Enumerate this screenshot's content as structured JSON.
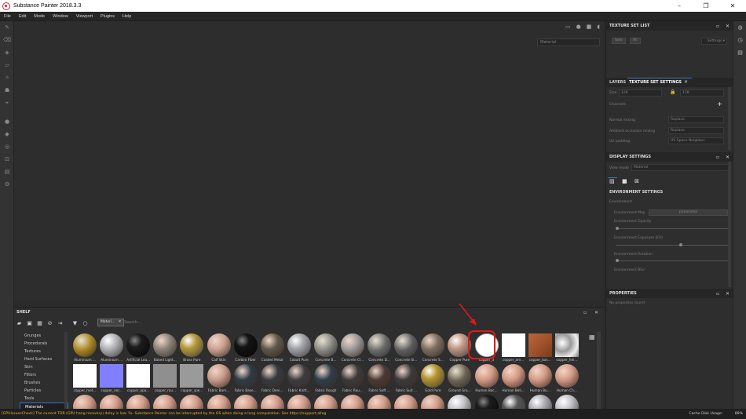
{
  "app": {
    "title": "Substance Painter 2018.3.3",
    "window_controls": [
      "–",
      "❐",
      "✕"
    ]
  },
  "menu": [
    "File",
    "Edit",
    "Mode",
    "Window",
    "Viewport",
    "Plugins",
    "Help"
  ],
  "viewport": {
    "material_label": "Material"
  },
  "texture_set_list": {
    "title": "TEXTURE SET LIST",
    "btn_a": "Solo",
    "btn_b": "All",
    "settings_label": "Settings ▾"
  },
  "tabs": {
    "layers": "LAYERS",
    "texture_set_settings": "TEXTURE SET SETTINGS"
  },
  "texture_set_settings": {
    "size_label": "Size",
    "size_a": "128",
    "size_b": "128",
    "channels_label": "Channels",
    "normal_mixing_label": "Normal mixing",
    "normal_mixing_value": "Replace",
    "ao_mixing_label": "Ambient occlusion mixing",
    "ao_mixing_value": "Replace",
    "uv_padding_label": "UV padding",
    "uv_padding_value": "UV Space Neighbor"
  },
  "display_settings": {
    "title": "DISPLAY SETTINGS",
    "view_mode_label": "View mode",
    "view_mode_value": "Material",
    "env_settings_title": "ENVIRONMENT SETTINGS",
    "environment_label": "Environment",
    "env_map_label": "Environment Map",
    "env_map_value": "panorama",
    "env_opacity_label": "Environment Opacity",
    "env_exposure_label": "Environment Exposure (EV)",
    "env_rotation_label": "Environment Rotation",
    "env_blur_label": "Environment Blur",
    "env_opacity_value": 0.0,
    "env_exposure_value": 0.58,
    "env_rotation_value": 0.0
  },
  "properties": {
    "title": "PROPERTIES",
    "empty_text": "No properties found"
  },
  "shelf": {
    "title": "SHELF",
    "filter_chip": "Materi...",
    "search_placeholder": "Search...",
    "categories": [
      "Grunges",
      "Procedurals",
      "Textures",
      "Hard Surfaces",
      "Skin",
      "Filters",
      "Brushes",
      "Particles",
      "Tools",
      "Materials"
    ],
    "active_category": "Materials",
    "row1": [
      {
        "name": "Aluminium ...",
        "color": "#a88420",
        "style": "grain"
      },
      {
        "name": "Aluminium ...",
        "color": "#b9b9bd",
        "style": "metal"
      },
      {
        "name": "Artificial Lea...",
        "color": "#1c1c1c",
        "style": "dark"
      },
      {
        "name": "Baked Light...",
        "color": "#8a8378",
        "style": "matte"
      },
      {
        "name": "Brass Pure",
        "color": "#b59a3a",
        "style": "metal"
      },
      {
        "name": "Calf Skin",
        "color": "#caa292",
        "style": "matte"
      },
      {
        "name": "Carbon Fiber",
        "color": "#141414",
        "style": "dark"
      },
      {
        "name": "Coated Metal",
        "color": "#5c5649",
        "style": "matte"
      },
      {
        "name": "Cobalt Pure",
        "color": "#a5a7ad",
        "style": "metal"
      },
      {
        "name": "Concrete B...",
        "color": "#888580",
        "style": "grain"
      },
      {
        "name": "Concrete Cl...",
        "color": "#9a9a9a",
        "style": "matte"
      },
      {
        "name": "Concrete D...",
        "color": "#6a6a6a",
        "style": "grain"
      },
      {
        "name": "Concrete Si...",
        "color": "#5d5d5d",
        "style": "grain"
      },
      {
        "name": "Concrete S...",
        "color": "#7a6e60",
        "style": "matte"
      },
      {
        "name": "Copper Pure",
        "color": "#c39a86",
        "style": "metal"
      },
      {
        "name": "copper_3",
        "color": "#ffffff",
        "style": "white"
      },
      {
        "name": "copper_am...",
        "color": "#ffffff",
        "style": "square"
      },
      {
        "name": "copper_bas...",
        "color": "#a0532c",
        "style": "rust"
      },
      {
        "name": "copper_hei...",
        "color": "#c8c8c8",
        "style": "cloud"
      }
    ],
    "row2": [
      {
        "name": "copper_met...",
        "color": "#ffffff",
        "style": "square"
      },
      {
        "name": "copper_nor...",
        "color": "#8080ff",
        "style": "square"
      },
      {
        "name": "copper_opa...",
        "color": "#ffffff",
        "style": "square"
      },
      {
        "name": "copper_rou...",
        "color": "#8f8f8f",
        "style": "square"
      },
      {
        "name": "copper_spe...",
        "color": "#9a9a9a",
        "style": "square"
      },
      {
        "name": "Fabric Bam...",
        "color": "#c99c8a",
        "style": "matte"
      },
      {
        "name": "Fabric Base...",
        "color": "#2c3b45",
        "style": "matte"
      },
      {
        "name": "Fabric Deni...",
        "color": "#343a40",
        "style": "matte"
      },
      {
        "name": "Fabric Knitt...",
        "color": "#3c3c40",
        "style": "matte"
      },
      {
        "name": "Fabric Rough",
        "color": "#2c3d4a",
        "style": "matte"
      },
      {
        "name": "Fabric Rou...",
        "color": "#3a3a3a",
        "style": "matte"
      },
      {
        "name": "Fabric Soft ...",
        "color": "#4a3a32",
        "style": "matte"
      },
      {
        "name": "Fabric Suit ...",
        "color": "#3a3a3a",
        "style": "matte"
      },
      {
        "name": "Gold Pure",
        "color": "#b8952f",
        "style": "metal"
      },
      {
        "name": "Ground Gra...",
        "color": "#6b6152",
        "style": "grain"
      },
      {
        "name": "Human Bac...",
        "color": "#d49a86",
        "style": "matte"
      },
      {
        "name": "Human Beli...",
        "color": "#d49a86",
        "style": "matte"
      },
      {
        "name": "Human Bu...",
        "color": "#d49a86",
        "style": "matte"
      },
      {
        "name": "Human Ch...",
        "color": "#d49a86",
        "style": "matte"
      }
    ],
    "row3_colors": [
      "#d19a88",
      "#d19a88",
      "#d19a88",
      "#d19a88",
      "#d19a88",
      "#d19a88",
      "#d19a88",
      "#d19a88",
      "#d19a88",
      "#d19a88",
      "#d19a88",
      "#d19a88",
      "#d19a88",
      "#d19a88",
      "#c8c8cc",
      "#1c1c1c",
      "#555555",
      "#b0b0b6",
      "#c8c8cc"
    ]
  },
  "status": {
    "message": "[GPUIssuesCheck] The current TDR (GPU hang recovery) delay is low: 5s. Substance Painter can be interrupted by the OS when doing a long computation. See https://support.alleg",
    "disk_usage_label": "Cache Disk Usage:",
    "disk_usage_value": "88%"
  },
  "colors": {
    "annotation": "#e01818",
    "accent_blue": "#3b72c8",
    "warning_text": "#e5b830"
  }
}
